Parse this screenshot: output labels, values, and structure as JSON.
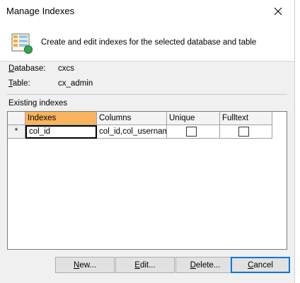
{
  "window": {
    "title": "Manage Indexes"
  },
  "header": {
    "description": "Create and edit indexes for the selected database and table",
    "icon": "index-table-icon"
  },
  "info": {
    "database_label_key": "D",
    "database_label_rest": "atabase:",
    "database_value": "cxcs",
    "table_label_key": "T",
    "table_label_rest": "able:",
    "table_value": "cx_admin"
  },
  "existing_label": "Existing indexes",
  "grid": {
    "columns": [
      "Indexes",
      "Columns",
      "Unique",
      "Fulltext"
    ],
    "selected_column": "Indexes",
    "rows": [
      {
        "marker": "*",
        "index": "col_id",
        "columns": "col_id,col_username",
        "unique": false,
        "fulltext": false
      }
    ]
  },
  "buttons": {
    "new_key": "N",
    "new_rest": "ew...",
    "edit_key": "E",
    "edit_rest": "dit...",
    "delete_key": "D",
    "delete_rest": "elete...",
    "cancel_key": "C",
    "cancel_rest": "ancel"
  },
  "colors": {
    "selected_header": "#f8b35e",
    "default_button_border": "#0078d7"
  }
}
